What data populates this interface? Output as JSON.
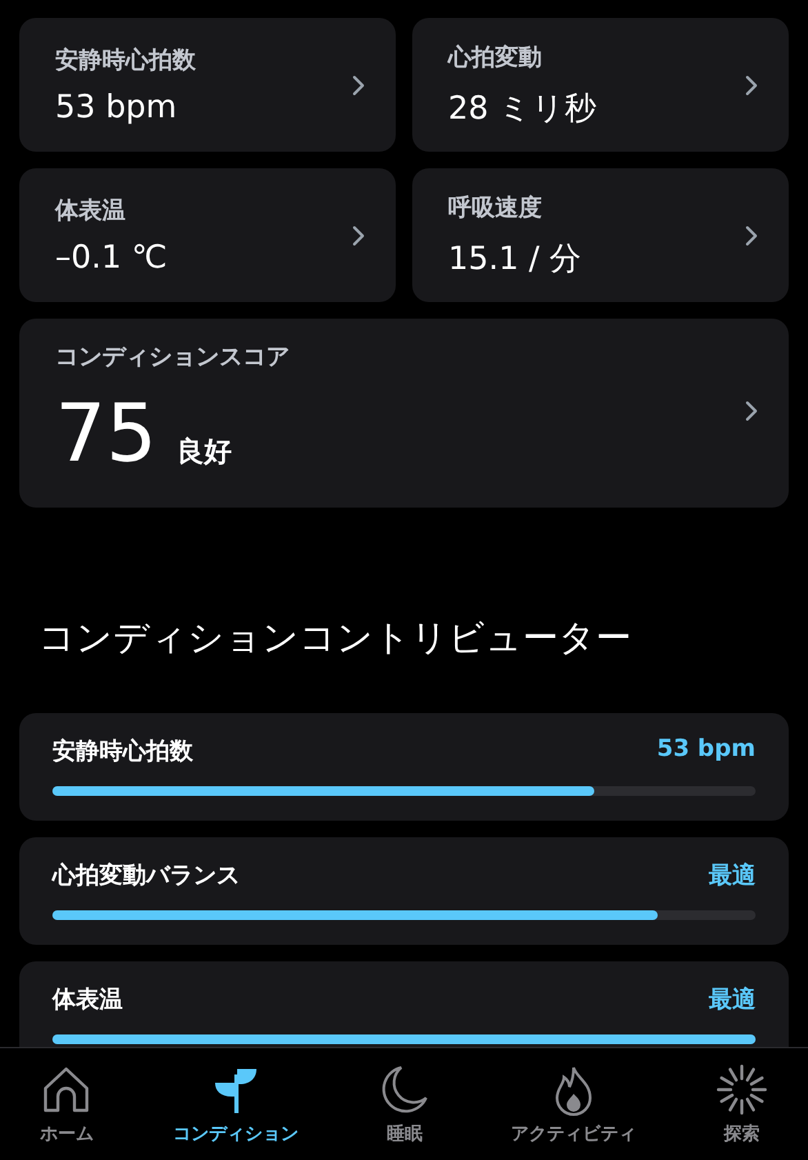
{
  "metrics": [
    {
      "label": "安静時心拍数",
      "value": "53 bpm"
    },
    {
      "label": "心拍変動",
      "value": "28 ミリ秒"
    },
    {
      "label": "体表温",
      "value": "–0.1 ℃"
    },
    {
      "label": "呼吸速度",
      "value": "15.1 / 分"
    }
  ],
  "score": {
    "label": "コンディションスコア",
    "value": "75",
    "rating": "良好"
  },
  "contributors_heading": "コンディションコントリビューター",
  "contributors": [
    {
      "label": "安静時心拍数",
      "reading": "53 bpm",
      "level": 0.77
    },
    {
      "label": "心拍変動バランス",
      "reading": "最適",
      "level": 0.86
    },
    {
      "label": "体表温",
      "reading": "最適",
      "level": 1.0
    }
  ],
  "tabs": [
    {
      "kind": "home",
      "label": "ホーム",
      "selected": false
    },
    {
      "kind": "sprout",
      "label": "コンディション",
      "selected": true
    },
    {
      "kind": "moon",
      "label": "睡眠",
      "selected": false
    },
    {
      "kind": "flame",
      "label": "アクティビティ",
      "selected": false
    },
    {
      "kind": "burst",
      "label": "探索",
      "selected": false
    }
  ]
}
